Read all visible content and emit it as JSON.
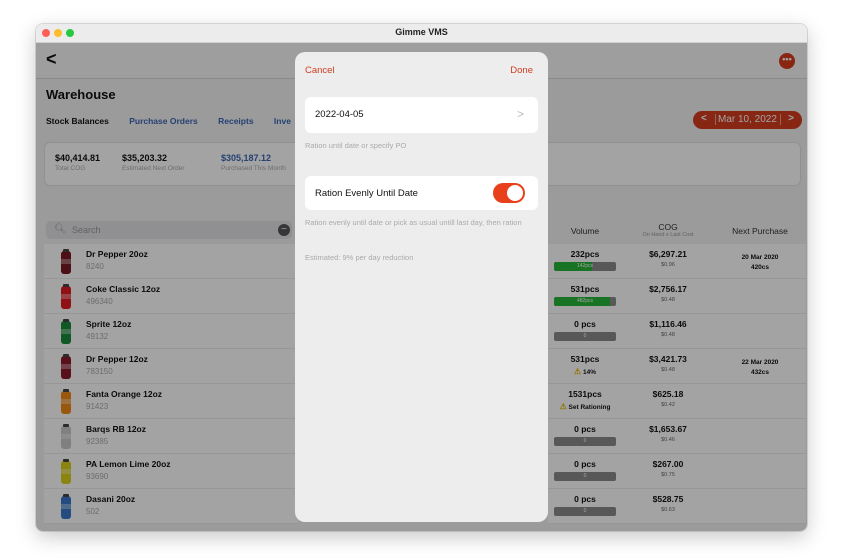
{
  "window": {
    "title": "Gimme VMS"
  },
  "nav": {
    "back": "<",
    "more": "•••"
  },
  "page": {
    "title": "Warehouse"
  },
  "tabs": [
    "Stock Balances",
    "Purchase Orders",
    "Receipts",
    "Inve"
  ],
  "date_picker": {
    "prev": "<",
    "date": "Mar 10, 2022",
    "next": ">"
  },
  "summary": [
    {
      "value": "$40,414.81",
      "label": "Total COG"
    },
    {
      "value": "$35,203.32",
      "label": "Estimated Next Order"
    },
    {
      "value": "$305,187.12",
      "label": "Purchased This Month"
    }
  ],
  "search": {
    "placeholder": "Search"
  },
  "products": [
    {
      "name": "Dr Pepper 20oz",
      "sku": "8240",
      "can_color": "#7a1a24"
    },
    {
      "name": "Coke Classic 12oz",
      "sku": "496340",
      "can_color": "#e21b22"
    },
    {
      "name": "Sprite 12oz",
      "sku": "49132",
      "can_color": "#1a8a3a"
    },
    {
      "name": "Dr Pepper 12oz",
      "sku": "783150",
      "can_color": "#8a1a2a"
    },
    {
      "name": "Fanta Orange 12oz",
      "sku": "91423",
      "can_color": "#f08a16"
    },
    {
      "name": "Barqs RB 12oz",
      "sku": "92385",
      "can_color": "#c8c8c8"
    },
    {
      "name": "PA Lemon Lime 20oz",
      "sku": "93690",
      "can_color": "#d8d01a"
    },
    {
      "name": "Dasani 20oz",
      "sku": "502",
      "can_color": "#3a78c8"
    }
  ],
  "columns": {
    "volume": "Volume",
    "cog": "COG",
    "cog_sub": "On Hand x Last Cost",
    "next_purchase": "Next Purchase"
  },
  "rows": [
    {
      "volume": "232pcs",
      "bar_label": "142pcs",
      "bar_fill": 0.61,
      "cog": "$6,297.21",
      "cog_sub": "$0.96",
      "np_date": "20 Mar 2020",
      "np_qty": "420cs"
    },
    {
      "volume": "531pcs",
      "bar_label": "482pcs",
      "bar_fill": 0.91,
      "cog": "$2,756.17",
      "cog_sub": "$0.48",
      "np_date": "",
      "np_qty": ""
    },
    {
      "volume": "0 pcs",
      "bar_label": "0",
      "bar_fill": 0,
      "cog": "$1,116.46",
      "cog_sub": "$0.48",
      "np_date": "",
      "np_qty": ""
    },
    {
      "volume": "531pcs",
      "warn": "14%",
      "cog": "$3,421.73",
      "cog_sub": "$0.48",
      "np_date": "22 Mar 2020",
      "np_qty": "432cs"
    },
    {
      "volume": "1531pcs",
      "warn": "Set Rationing",
      "cog": "$625.18",
      "cog_sub": "$0.42",
      "np_date": "",
      "np_qty": ""
    },
    {
      "volume": "0 pcs",
      "bar_label": "0",
      "bar_fill": 0,
      "cog": "$1,653.67",
      "cog_sub": "$0.46",
      "np_date": "",
      "np_qty": ""
    },
    {
      "volume": "0 pcs",
      "bar_label": "0",
      "bar_fill": 0,
      "cog": "$267.00",
      "cog_sub": "$0.75",
      "np_date": "",
      "np_qty": ""
    },
    {
      "volume": "0 pcs",
      "bar_label": "0",
      "bar_fill": 0,
      "cog": "$528.75",
      "cog_sub": "$0.63",
      "np_date": "",
      "np_qty": ""
    }
  ],
  "modal": {
    "cancel": "Cancel",
    "done": "Done",
    "date_value": "2022-04-05",
    "date_chevron": ">",
    "date_note": "Ration until date or specify PO",
    "toggle_label": "Ration Evenly Until Date",
    "toggle_on": true,
    "toggle_note": "Ration evenly until date or pick as usual untill last day, then ration",
    "estimate": "Estimated: 9% per day reduction"
  },
  "colors": {
    "accent": "#d33c1f",
    "link": "#3a67b3",
    "bar_green": "#27b53a",
    "warning": "#e5b800"
  }
}
